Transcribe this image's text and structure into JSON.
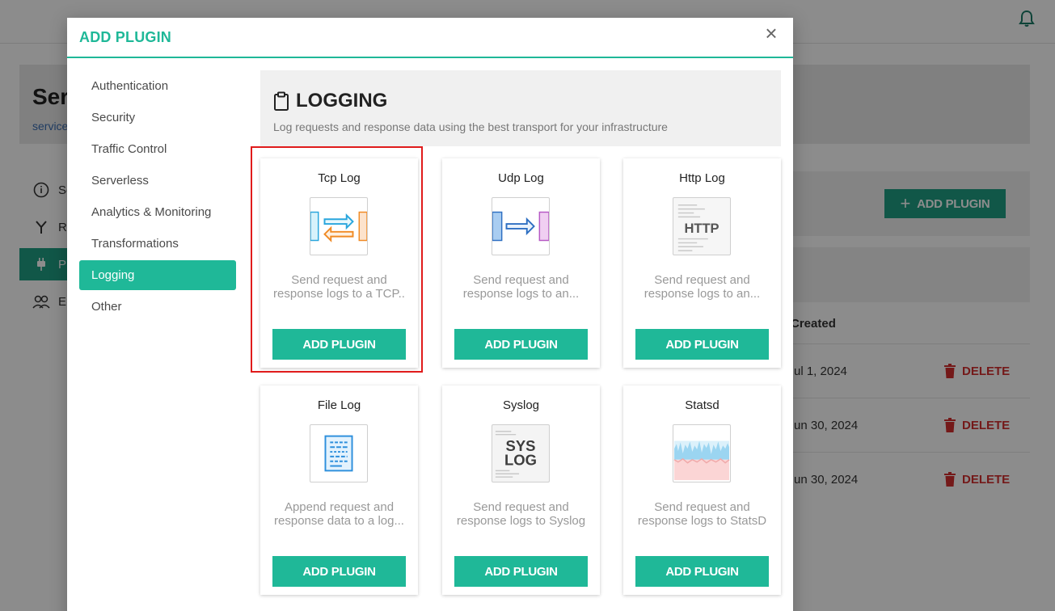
{
  "background": {
    "title": "Ser",
    "breadcrumb": "service",
    "nav": [
      {
        "label": "Se",
        "icon": "info-icon"
      },
      {
        "label": "Ro",
        "icon": "route-icon"
      },
      {
        "label": "Pl",
        "icon": "plug-icon"
      },
      {
        "label": "El",
        "icon": "users-icon"
      }
    ],
    "add_plugin_label": "ADD PLUGIN",
    "created_header": "Created",
    "rows": [
      {
        "date": "ul 1, 2024",
        "action": "DELETE"
      },
      {
        "date": "un 30, 2024",
        "action": "DELETE"
      },
      {
        "date": "un 30, 2024",
        "action": "DELETE"
      }
    ]
  },
  "modal": {
    "title": "ADD PLUGIN",
    "close_symbol": "×",
    "categories": [
      "Authentication",
      "Security",
      "Traffic Control",
      "Serverless",
      "Analytics & Monitoring",
      "Transformations",
      "Logging",
      "Other"
    ],
    "active_category": "Logging",
    "section": {
      "title": "LOGGING",
      "icon": "clipboard-icon",
      "description": "Log requests and response data using the best transport for your infrastructure"
    },
    "plugins": [
      {
        "name": "Tcp Log",
        "icon": "tcp-log-icon",
        "desc_line1": "Send request and",
        "desc_line2": "response logs to a TCP..",
        "button": "ADD PLUGIN"
      },
      {
        "name": "Udp Log",
        "icon": "udp-log-icon",
        "desc_line1": "Send request and",
        "desc_line2": "response logs to an...",
        "button": "ADD PLUGIN"
      },
      {
        "name": "Http Log",
        "icon": "http-log-icon",
        "desc_line1": "Send request and",
        "desc_line2": "response logs to an...",
        "button": "ADD PLUGIN"
      },
      {
        "name": "File Log",
        "icon": "file-log-icon",
        "desc_line1": "Append request and",
        "desc_line2": "response data to a log...",
        "button": "ADD PLUGIN"
      },
      {
        "name": "Syslog",
        "icon": "syslog-icon",
        "desc_line1": "Send request and",
        "desc_line2": "response logs to Syslog",
        "button": "ADD PLUGIN"
      },
      {
        "name": "Statsd",
        "icon": "statsd-icon",
        "desc_line1": "Send request and",
        "desc_line2": "response logs to StatsD",
        "button": "ADD PLUGIN"
      }
    ],
    "http_icon_text": "HTTP",
    "syslog_icon_text_1": "SYS",
    "syslog_icon_text_2": "LOG"
  },
  "colors": {
    "accent": "#1fb898",
    "highlight": "#e01b1b",
    "delete": "#d32f2f"
  }
}
